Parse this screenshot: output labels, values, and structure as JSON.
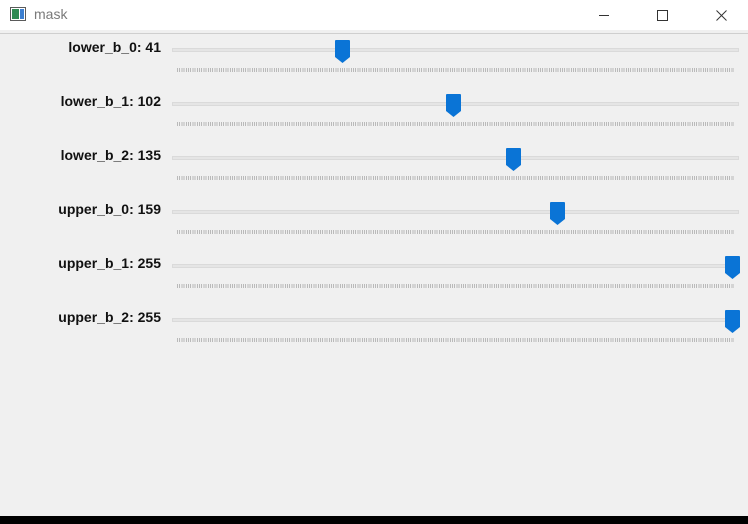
{
  "window": {
    "title": "mask"
  },
  "accent_color": "#0a74d6",
  "sliders": [
    {
      "label": "lower_b_0: 41",
      "value": 41,
      "max": 255
    },
    {
      "label": "lower_b_1: 102",
      "value": 102,
      "max": 255
    },
    {
      "label": "lower_b_2: 135",
      "value": 135,
      "max": 255
    },
    {
      "label": "upper_b_0: 159",
      "value": 159,
      "max": 255
    },
    {
      "label": "upper_b_1: 255",
      "value": 255,
      "max": 255
    },
    {
      "label": "upper_b_2: 255",
      "value": 255,
      "max": 255
    }
  ]
}
